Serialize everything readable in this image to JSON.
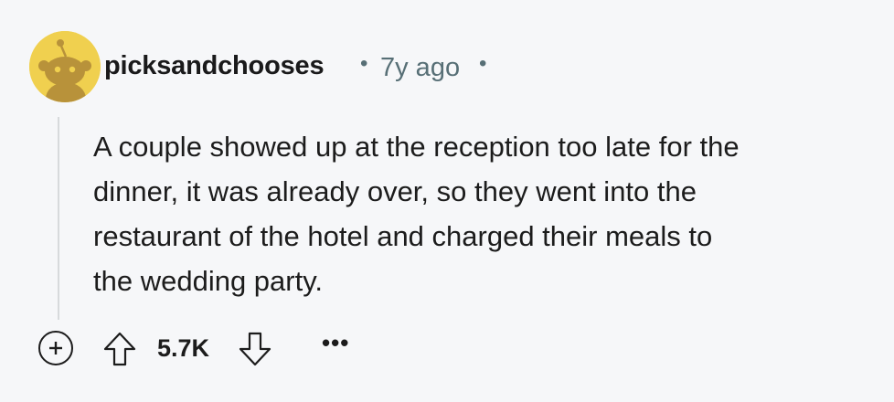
{
  "comment": {
    "author": "picksandchooses",
    "separator": "•",
    "timestamp": "7y ago",
    "body_lines": [
      "A couple showed up at the reception too late for the",
      "dinner, it was already over, so they went into the",
      "restaurant of the hotel and charged their meals to",
      "the wedding party."
    ],
    "score": "5.7K",
    "more_label": "•••",
    "avatar_icon": "snoo-avatar-icon",
    "avatar_color": "#f0d04f"
  },
  "actions": {
    "expand_icon": "plus-circle-icon",
    "upvote_icon": "arrow-up-icon",
    "downvote_icon": "arrow-down-icon"
  }
}
